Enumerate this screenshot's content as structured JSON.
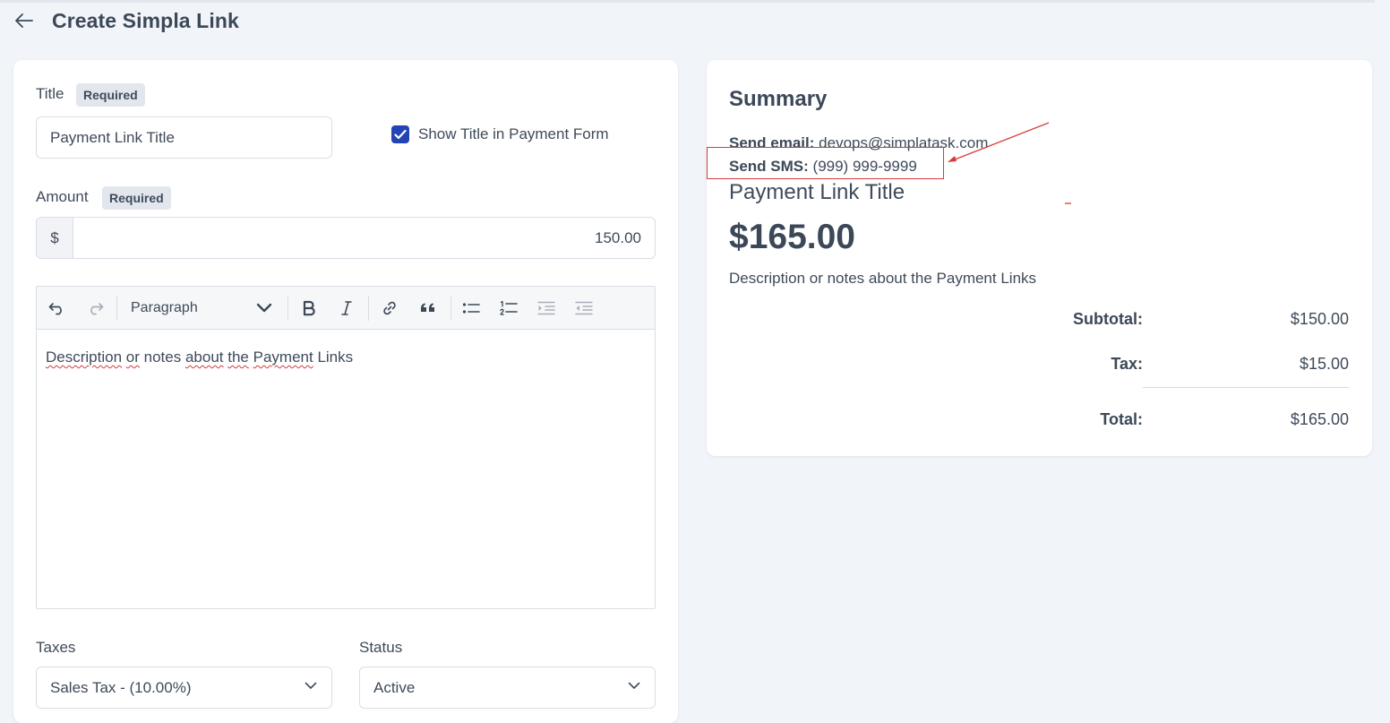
{
  "header": {
    "title": "Create Simpla Link",
    "back_icon": "arrow-left-icon"
  },
  "form": {
    "title_label": "Title",
    "title_badge": "Required",
    "title_value": "Payment Link Title",
    "show_title_checked": true,
    "show_title_label": "Show Title in Payment Form",
    "amount_label": "Amount",
    "amount_badge": "Required",
    "amount_prefix": "$",
    "amount_value": "150.00",
    "editor": {
      "toolbar": {
        "undo_icon": "undo-icon",
        "redo_icon": "redo-icon",
        "paragraph_label": "Paragraph",
        "bold_icon": "bold-icon",
        "italic_icon": "italic-icon",
        "link_icon": "link-icon",
        "quote_icon": "quote-icon",
        "bullet_list_icon": "bulleted-list-icon",
        "numbered_list_icon": "numbered-list-icon",
        "indent_icon": "indent-icon",
        "outdent_icon": "outdent-icon"
      },
      "content_words": [
        "Description",
        "or",
        "notes",
        "about",
        "the",
        "Payment",
        "Links"
      ]
    },
    "taxes_label": "Taxes",
    "taxes_value": "Sales Tax - (10.00%)",
    "status_label": "Status",
    "status_value": "Active"
  },
  "summary": {
    "title": "Summary",
    "send_email_label": "Send email:",
    "send_email_value": "devops@simplatask.com",
    "send_sms_label": "Send SMS:",
    "send_sms_value": "(999) 999-9999",
    "payment_title": "Payment Link Title",
    "total_big": "$165.00",
    "description": "Description or notes about the Payment Links",
    "subtotal_label": "Subtotal:",
    "subtotal_value": "$150.00",
    "tax_label": "Tax:",
    "tax_value": "$15.00",
    "total_label": "Total:",
    "total_value": "$165.00"
  },
  "colors": {
    "accent": "#2443b6",
    "background": "#f1f4f8",
    "annotation": "#d83a3a"
  }
}
